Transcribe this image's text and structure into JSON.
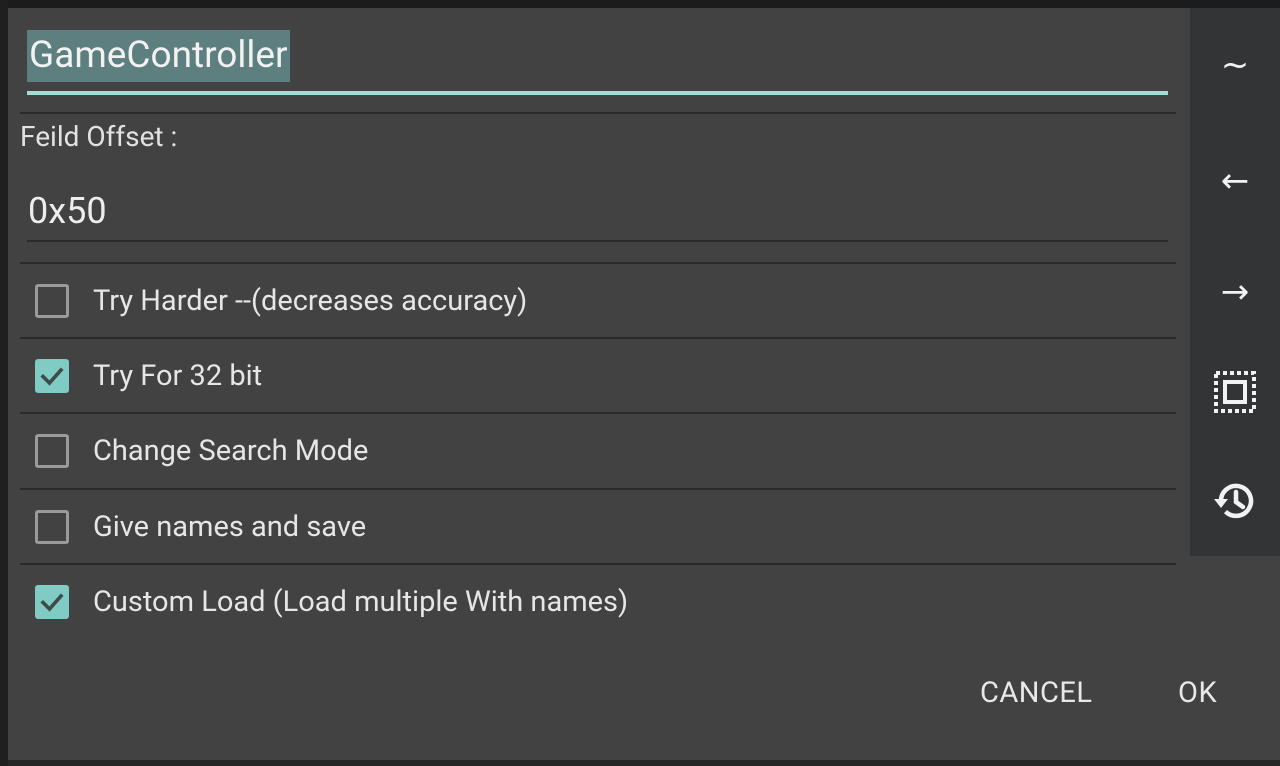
{
  "dialog": {
    "name_field": {
      "value": "GameController"
    },
    "offset": {
      "label": "Feild Offset :",
      "value": "0x50"
    },
    "options": [
      {
        "label": "Try Harder --(decreases accuracy)",
        "checked": false
      },
      {
        "label": "Try For 32 bit",
        "checked": true
      },
      {
        "label": "Change Search Mode",
        "checked": false
      },
      {
        "label": "Give names and save",
        "checked": false
      },
      {
        "label": "Custom Load (Load multiple With names)",
        "checked": true
      }
    ],
    "buttons": {
      "cancel": "CANCEL",
      "ok": "OK"
    }
  },
  "side_toolbar": {
    "items": [
      {
        "icon": "tilde-icon",
        "glyph": "~"
      },
      {
        "icon": "arrow-left-icon",
        "glyph": "←"
      },
      {
        "icon": "arrow-right-icon",
        "glyph": "→"
      },
      {
        "icon": "select-all-icon"
      },
      {
        "icon": "history-icon"
      }
    ]
  },
  "colors": {
    "accent": "#80cbc4",
    "dialog_bg": "#424242",
    "toolbar_bg": "#333436",
    "selection": "#5e7f7f"
  }
}
